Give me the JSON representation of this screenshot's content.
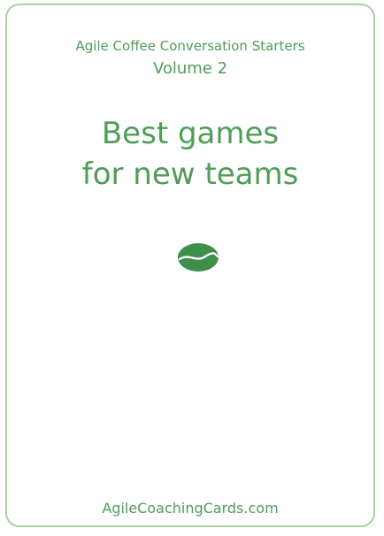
{
  "card": {
    "series": "Agile Coffee Conversation Starters",
    "volume": "Volume 2",
    "title_line1": "Best games",
    "title_line2": "for new teams",
    "footer": "AgileCoachingCards.com",
    "icon": "coffee-bean-icon"
  },
  "colors": {
    "text": "#4f9d57",
    "border": "#a9d0a6",
    "bean": "#3d8f4a",
    "background": "#ffffff"
  }
}
